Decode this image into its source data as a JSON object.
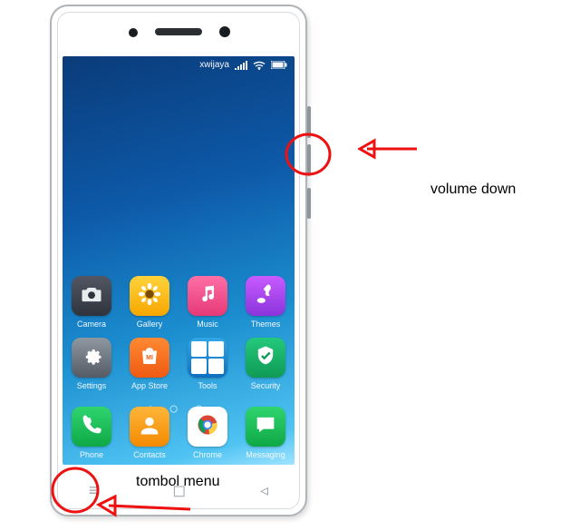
{
  "status": {
    "user": "xwijaya"
  },
  "apps": {
    "camera": {
      "label": "Camera"
    },
    "gallery": {
      "label": "Gallery"
    },
    "music": {
      "label": "Music"
    },
    "themes": {
      "label": "Themes"
    },
    "settings": {
      "label": "Settings"
    },
    "store": {
      "label": "App Store"
    },
    "tools": {
      "label": "Tools"
    },
    "security": {
      "label": "Security"
    }
  },
  "dock": {
    "phone": {
      "label": "Phone"
    },
    "contacts": {
      "label": "Contacts"
    },
    "chrome": {
      "label": "Chrome"
    },
    "msg": {
      "label": "Messaging"
    }
  },
  "annotations": {
    "volume_down": "volume down",
    "menu_button": "tombol menu"
  }
}
